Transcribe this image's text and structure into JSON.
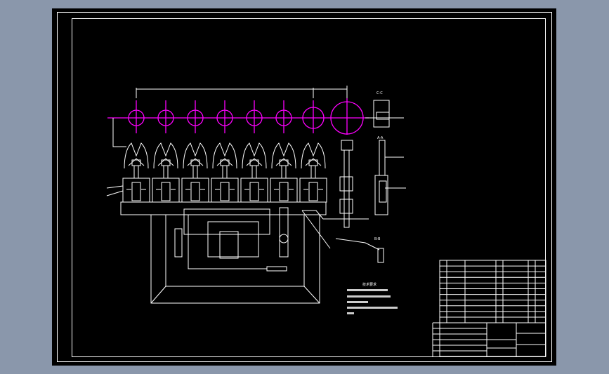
{
  "viewer": {
    "background_color": "#8a97ab",
    "canvas_color": "#000000",
    "line_color": "#ffffff",
    "centerline_color": "#ff00ff"
  },
  "drawing": {
    "station_count": 7,
    "section_labels": [
      "C-C",
      "A-A",
      "B-B"
    ],
    "notes_title": "技术要求"
  }
}
